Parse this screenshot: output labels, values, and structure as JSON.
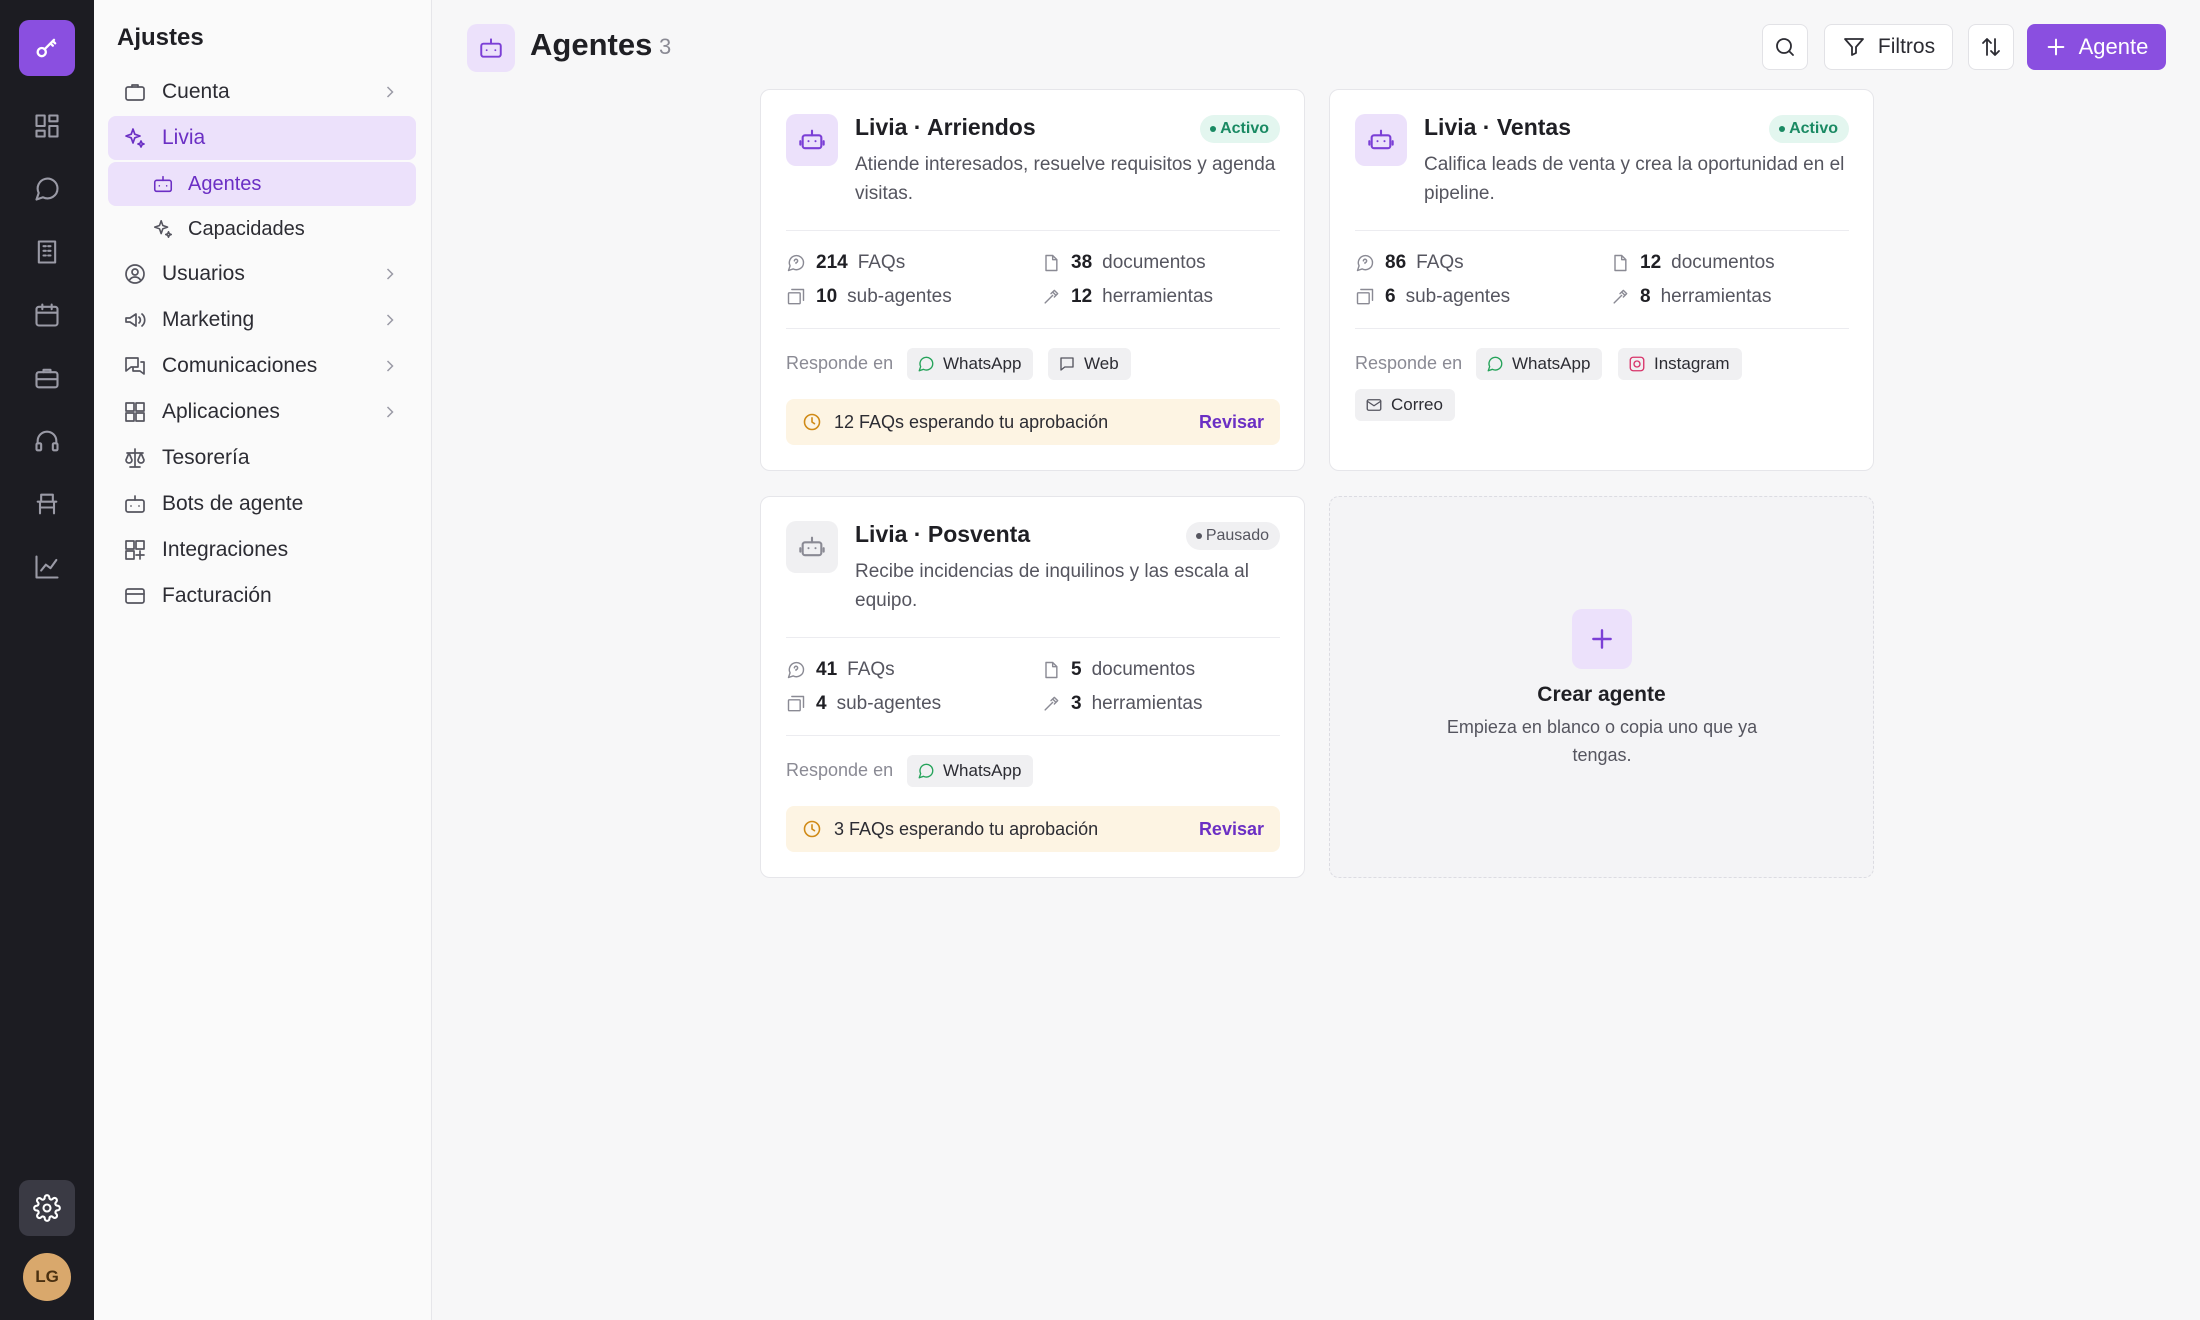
{
  "rail": {
    "items": [
      "key-icon",
      "dashboard-icon",
      "chat-icon",
      "building-icon",
      "calendar-icon",
      "briefcase-icon",
      "headset-icon",
      "desk-icon",
      "chart-icon"
    ],
    "settings_icon": "gear-icon",
    "avatar_initials": "LG",
    "accent": "#8a4fe0"
  },
  "sidebar": {
    "title": "Ajustes",
    "items": [
      {
        "label": "Cuenta"
      },
      {
        "label": "Livia"
      },
      {
        "label": "Agentes"
      },
      {
        "label": "Capacidades"
      },
      {
        "label": "Usuarios"
      },
      {
        "label": "Marketing"
      },
      {
        "label": "Comunicaciones"
      },
      {
        "label": "Aplicaciones"
      },
      {
        "label": "Tesorería"
      },
      {
        "label": "Bots de agente"
      },
      {
        "label": "Integraciones"
      },
      {
        "label": "Facturación"
      }
    ]
  },
  "header": {
    "title": "Agentes",
    "count": "3",
    "filters_label": "Filtros",
    "new_label": "Agente"
  },
  "agents": [
    {
      "name": "Livia · Arriendos",
      "status": "Activo",
      "description": "Atiende interesados, resuelve requisitos y agenda visitas.",
      "faqs": "214",
      "faqs_label": "FAQs",
      "docs": "38",
      "docs_label": "documentos",
      "subagents": "10",
      "subagents_label": "sub-agentes",
      "tools": "12",
      "tools_label": "herramientas",
      "responds_label": "Responde en",
      "channels": [
        "WhatsApp",
        "Web"
      ],
      "pending": "12 FAQs esperando tu aprobación",
      "review": "Revisar"
    },
    {
      "name": "Livia · Ventas",
      "status": "Activo",
      "description": "Califica leads de venta y crea la oportunidad en el pipeline.",
      "faqs": "86",
      "faqs_label": "FAQs",
      "docs": "12",
      "docs_label": "documentos",
      "subagents": "6",
      "subagents_label": "sub-agentes",
      "tools": "8",
      "tools_label": "herramientas",
      "responds_label": "Responde en",
      "channels": [
        "WhatsApp",
        "Instagram",
        "Correo"
      ]
    },
    {
      "name": "Livia · Posventa",
      "status": "Pausado",
      "description": "Recibe incidencias de inquilinos y las escala al equipo.",
      "faqs": "41",
      "faqs_label": "FAQs",
      "docs": "5",
      "docs_label": "documentos",
      "subagents": "4",
      "subagents_label": "sub-agentes",
      "tools": "3",
      "tools_label": "herramientas",
      "responds_label": "Responde en",
      "channels": [
        "WhatsApp"
      ],
      "pending": "3 FAQs esperando tu aprobación",
      "review": "Revisar"
    }
  ],
  "create": {
    "title": "Crear agente",
    "subtitle": "Empieza en blanco o copia uno que ya tengas."
  },
  "colors": {
    "whatsapp": "#25a35a",
    "instagram": "#d8336a",
    "active_badge": "#1a8a63",
    "pending_bg": "#fdf4e3"
  }
}
